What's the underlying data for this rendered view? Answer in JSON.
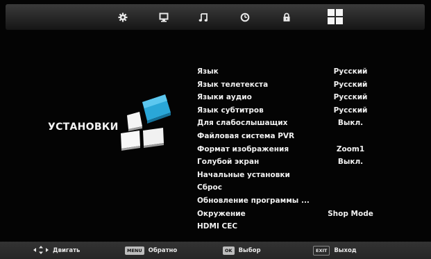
{
  "top_bar": {
    "icons": [
      "gear-icon",
      "picture-icon",
      "music-note-icon",
      "clock-icon",
      "lock-icon",
      "grid-icon"
    ],
    "active": "grid-icon"
  },
  "menu": {
    "title": "УСТАНОВКИ",
    "items": [
      {
        "label": "Язык",
        "value": "Русский"
      },
      {
        "label": "Язык телетекста",
        "value": "Русский"
      },
      {
        "label": "Языки аудио",
        "value": "Русский"
      },
      {
        "label": "Язык субтитров",
        "value": "Русский"
      },
      {
        "label": "Для слабослышащих",
        "value": "Выкл."
      },
      {
        "label": "Файловая система PVR",
        "value": ""
      },
      {
        "label": "Формат изображения",
        "value": "Zoom1"
      },
      {
        "label": "Голубой экран",
        "value": "Выкл."
      },
      {
        "label": "Начальные установки",
        "value": ""
      },
      {
        "label": "Сброс",
        "value": ""
      },
      {
        "label": "Обновление программы ...",
        "value": ""
      },
      {
        "label": "Окружение",
        "value": "Shop Mode"
      },
      {
        "label": "HDMI CEC",
        "value": ""
      }
    ]
  },
  "bottom_bar": {
    "move": {
      "label": "Двигать"
    },
    "back": {
      "key": "MENU",
      "label": "Обратно"
    },
    "select": {
      "key": "OK",
      "label": "Выбор"
    },
    "exit": {
      "key": "EXIT",
      "label": "Выход"
    }
  },
  "colors": {
    "background": "#050505",
    "tile_blue": "#2aa7d8",
    "tile_white": "#f4f4f4",
    "text": "#f2f2f2"
  }
}
